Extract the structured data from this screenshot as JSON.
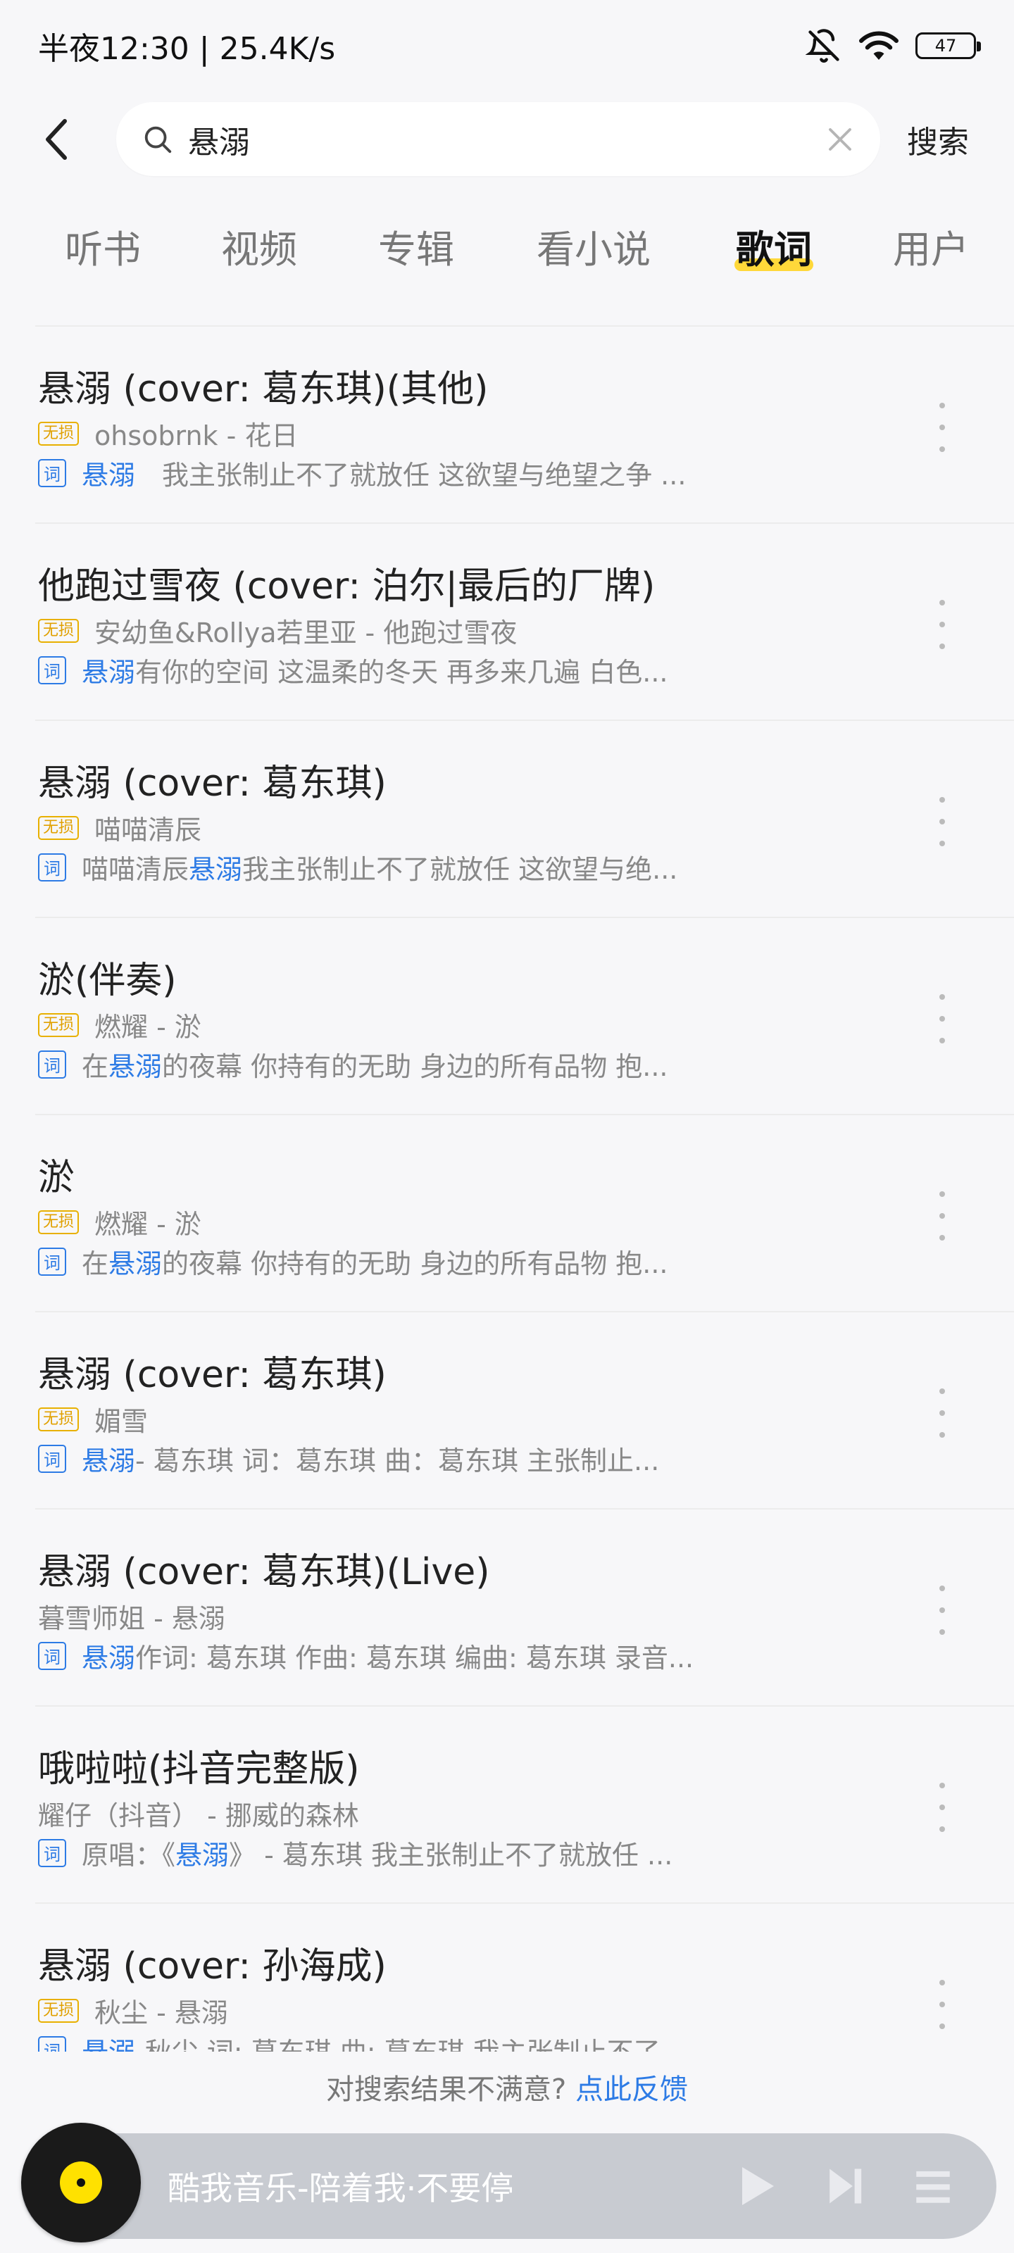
{
  "status_bar": {
    "time": "半夜12:30 | 25.4K/s",
    "battery": "47"
  },
  "search": {
    "query": "悬溺",
    "button": "搜索"
  },
  "tabs": [
    {
      "label": "听书"
    },
    {
      "label": "视频"
    },
    {
      "label": "专辑"
    },
    {
      "label": "看小说"
    },
    {
      "label": "歌词",
      "active": true
    },
    {
      "label": "用户"
    }
  ],
  "colors": {
    "accent": "#2d7be5",
    "tab_underline": "#ffd83a",
    "hq_badge": "#e8b000"
  },
  "badges": {
    "hq": "无损",
    "lyric": "词"
  },
  "results": [
    {
      "title": "悬溺 (cover: 葛东琪)(其他)",
      "hq": true,
      "artist": "ohsobrnk - 花日",
      "lyric_pre": "",
      "lyric_hl": "悬溺",
      "lyric_post": "　我主张制止不了就放任 这欲望与绝望之争 ..."
    },
    {
      "title": "他跑过雪夜 (cover: 泊尔|最后的厂牌)",
      "hq": true,
      "artist": "安幼鱼&Rollya若里亚 - 他跑过雪夜",
      "lyric_pre": "",
      "lyric_hl": "悬溺",
      "lyric_post": "有你的空间 这温柔的冬天 再多来几遍 白色..."
    },
    {
      "title": "悬溺 (cover: 葛东琪)",
      "hq": true,
      "artist": "喵喵清辰",
      "lyric_pre": "喵喵清辰",
      "lyric_hl": "悬溺",
      "lyric_post": " 我主张制止不了就放任 这欲望与绝..."
    },
    {
      "title": "淤(伴奏)",
      "hq": true,
      "artist": "燃耀 - 淤",
      "lyric_pre": "在",
      "lyric_hl": "悬溺",
      "lyric_post": "的夜幕 你持有的无助 身边的所有品物 抱..."
    },
    {
      "title": "淤",
      "hq": true,
      "artist": "燃耀 - 淤",
      "lyric_pre": "在",
      "lyric_hl": "悬溺",
      "lyric_post": "的夜幕 你持有的无助 身边的所有品物 抱..."
    },
    {
      "title": "悬溺 (cover: 葛东琪)",
      "hq": true,
      "artist": "媚雪",
      "lyric_pre": "",
      "lyric_hl": "悬溺",
      "lyric_post": " - 葛东琪  词：葛东琪  曲：葛东琪  主张制止..."
    },
    {
      "title": "悬溺 (cover: 葛东琪)(Live)",
      "hq": false,
      "artist": "暮雪师姐 - 悬溺",
      "lyric_pre": "",
      "lyric_hl": "悬溺",
      "lyric_post": " 作词: 葛东琪 作曲: 葛东琪 编曲: 葛东琪 录音..."
    },
    {
      "title": "哦啦啦(抖音完整版)",
      "hq": false,
      "artist": "耀仔（抖音） - 挪威的森林",
      "lyric_pre": "原唱：《",
      "lyric_hl": "悬溺",
      "lyric_post": "》 - 葛东琪 我主张制止不了就放任 ..."
    },
    {
      "title": "悬溺 (cover: 孙海成)",
      "hq": true,
      "artist": "秋尘 - 悬溺",
      "lyric_pre": "",
      "lyric_hl": "悬溺",
      "lyric_post": "-秋尘 词: 葛东琪 曲: 葛东琪 我主张制止不了"
    }
  ],
  "feedback": {
    "text": "对搜索结果不满意?",
    "link": "点此反馈"
  },
  "player": {
    "title": "酷我音乐-陪着我·不要停"
  }
}
